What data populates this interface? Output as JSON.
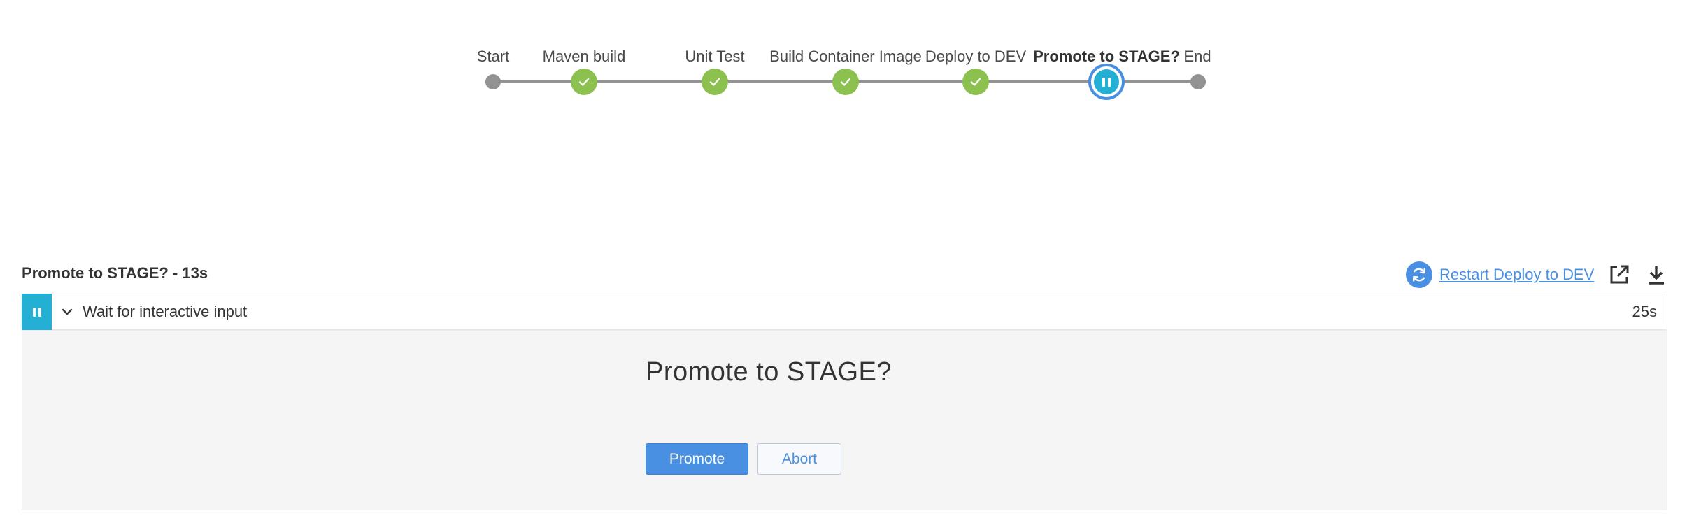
{
  "pipeline": {
    "stages": [
      {
        "label": "Start",
        "status": "not-built"
      },
      {
        "label": "Maven build",
        "status": "success"
      },
      {
        "label": "Unit Test",
        "status": "success"
      },
      {
        "label": "Build Container Image",
        "status": "success"
      },
      {
        "label": "Deploy to DEV",
        "status": "success"
      },
      {
        "label": "Promote to STAGE?",
        "status": "paused"
      },
      {
        "label": "End",
        "status": "not-built"
      }
    ]
  },
  "step_header": {
    "title": "Promote to STAGE? - 13s",
    "restart_label": "Restart Deploy to DEV"
  },
  "log_row": {
    "label": "Wait for interactive input",
    "duration": "25s"
  },
  "input_panel": {
    "message": "Promote to STAGE?",
    "proceed_label": "Promote",
    "abort_label": "Abort"
  },
  "colors": {
    "success": "#8cc04f",
    "paused": "#24b0d5",
    "accent": "#4a90e2",
    "line": "#949393"
  },
  "icons": {
    "success": "check-icon",
    "paused": "pause-icon",
    "restart": "refresh-icon",
    "open": "external-link-icon",
    "download": "download-icon",
    "expand": "chevron-down-icon"
  }
}
